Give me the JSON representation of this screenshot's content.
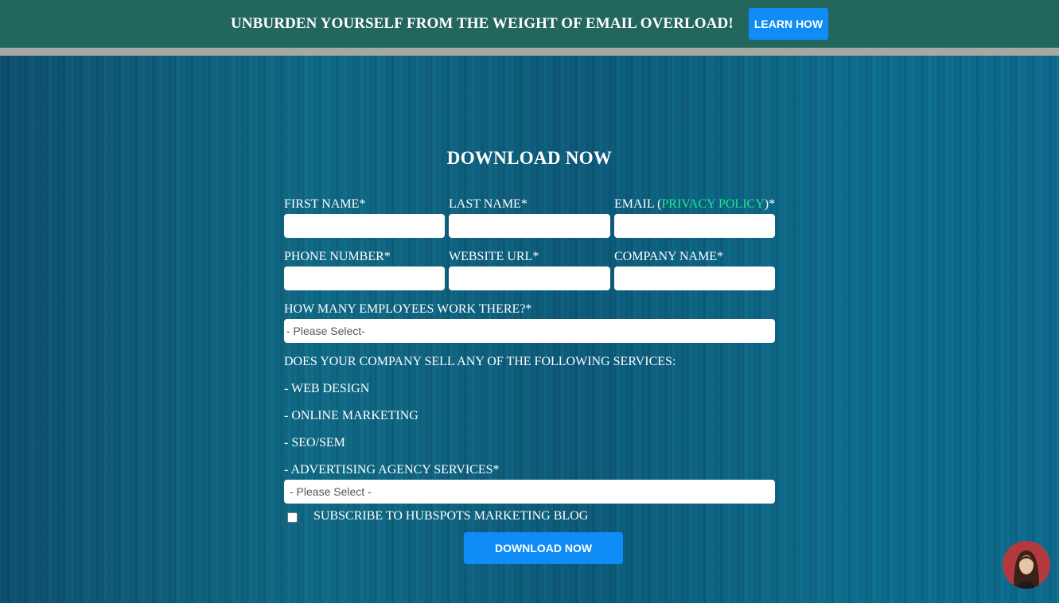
{
  "banner": {
    "text": "UNBURDEN YOURSELF FROM THE WEIGHT OF EMAIL OVERLOAD!",
    "button_label": "LEARN HOW"
  },
  "form": {
    "title": "DOWNLOAD NOW",
    "first_name_label": "FIRST NAME*",
    "last_name_label": "LAST NAME*",
    "email_label_prefix": "EMAIL (",
    "privacy_link": "PRIVACY POLICY",
    "email_label_suffix": ")*",
    "phone_label": "PHONE NUMBER*",
    "website_label": "WEBSITE URL*",
    "company_label": "COMPANY NAME*",
    "employees_label": "HOW MANY EMPLOYEES WORK THERE?*",
    "employees_value": "- Please Select-",
    "services_question": "DOES YOUR COMPANY SELL ANY OF THE FOLLOWING SERVICES:",
    "services": [
      "- WEB DESIGN",
      "- ONLINE MARKETING",
      "- SEO/SEM",
      "- ADVERTISING AGENCY SERVICES*"
    ],
    "services_value": "- Please Select -",
    "subscribe_label": "SUBSCRIBE TO HUBSPOTS MARKETING BLOG",
    "submit_label": "DOWNLOAD NOW"
  },
  "colors": {
    "banner_bg": "#23665d",
    "button_blue": "#0f8cf5",
    "link_green": "#1de98b",
    "hero_teal": "#0b5e7e"
  }
}
